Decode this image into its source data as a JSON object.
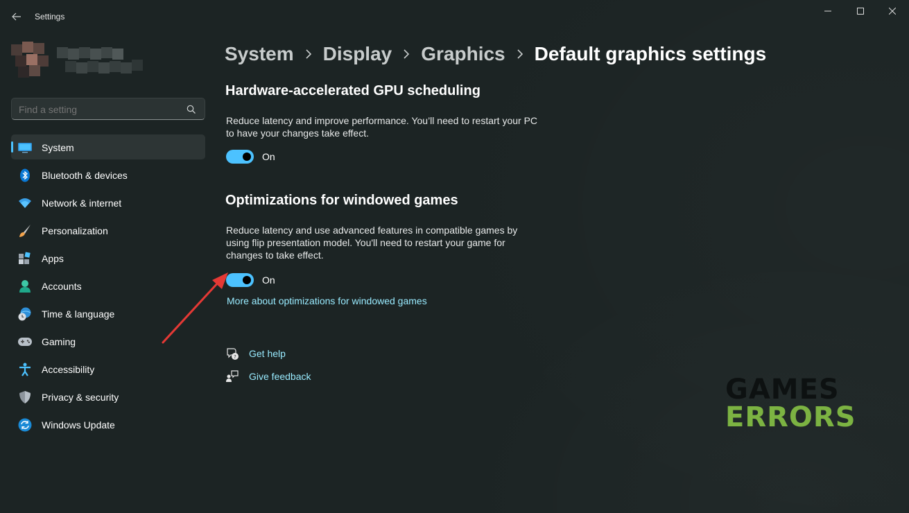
{
  "app": {
    "title": "Settings"
  },
  "search": {
    "placeholder": "Find a setting"
  },
  "sidebar": {
    "items": [
      {
        "label": "System",
        "icon": "monitor-icon",
        "selected": true
      },
      {
        "label": "Bluetooth & devices",
        "icon": "bluetooth-icon"
      },
      {
        "label": "Network & internet",
        "icon": "wifi-icon"
      },
      {
        "label": "Personalization",
        "icon": "brush-icon"
      },
      {
        "label": "Apps",
        "icon": "apps-icon"
      },
      {
        "label": "Accounts",
        "icon": "person-icon"
      },
      {
        "label": "Time & language",
        "icon": "globe-clock-icon"
      },
      {
        "label": "Gaming",
        "icon": "gamepad-icon"
      },
      {
        "label": "Accessibility",
        "icon": "accessibility-icon"
      },
      {
        "label": "Privacy & security",
        "icon": "shield-icon"
      },
      {
        "label": "Windows Update",
        "icon": "update-icon"
      }
    ]
  },
  "breadcrumb": [
    "System",
    "Display",
    "Graphics",
    "Default graphics settings"
  ],
  "gpu_scheduling": {
    "title": "Hardware-accelerated GPU scheduling",
    "description": "Reduce latency and improve performance. You’ll need to restart your PC to have your changes take effect.",
    "state": "On",
    "enabled": true
  },
  "windowed_games": {
    "title": "Optimizations for windowed games",
    "description": "Reduce latency and use advanced features in compatible games by using flip presentation model. You'll need to restart your game for changes to take effect.",
    "state": "On",
    "enabled": true,
    "link": "More about optimizations for windowed games"
  },
  "help": {
    "get_help": "Get help",
    "give_feedback": "Give feedback"
  },
  "watermark": {
    "line1": "GAMES",
    "line2": "ERRORS"
  },
  "colors": {
    "accent": "#4cc2ff",
    "link": "#99ebff",
    "background": "#1c2424",
    "arrow": "#e53935",
    "watermark_green": "#7cb342"
  }
}
